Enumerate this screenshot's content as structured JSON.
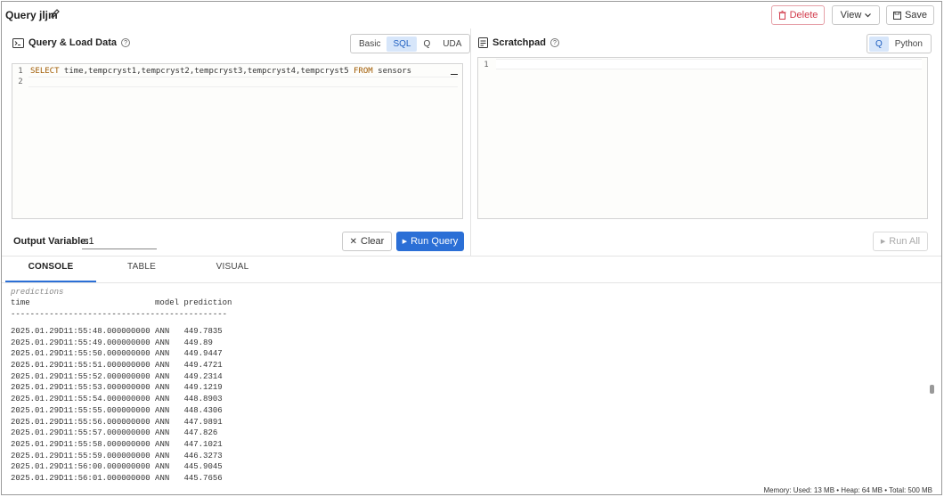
{
  "header": {
    "title": "Query jljm",
    "delete_label": "Delete",
    "view_label": "View",
    "save_label": "Save"
  },
  "query_panel": {
    "title": "Query & Load Data",
    "modes": [
      "Basic",
      "SQL",
      "Q",
      "UDA"
    ],
    "active_mode": "SQL",
    "editor_lines": [
      {
        "num": "1",
        "keyword1": "SELECT",
        "middle": " time,tempcryst1,tempcryst2,tempcryst3,tempcryst4,tempcryst5 ",
        "keyword2": "FROM",
        "tail": " sensors"
      },
      {
        "num": "2"
      }
    ],
    "output_variable_label": "Output Variable:",
    "output_variable_value": "s1",
    "clear_label": "Clear",
    "run_label": "Run Query"
  },
  "scratchpad": {
    "title": "Scratchpad",
    "modes": [
      "Q",
      "Python"
    ],
    "active_mode": "Q",
    "editor_line_number": "1",
    "run_all_label": "Run All"
  },
  "tabs": [
    "CONSOLE",
    "TABLE",
    "VISUAL"
  ],
  "active_tab": "CONSOLE",
  "console": {
    "label": "predictions",
    "header": "time                          model prediction",
    "separator": "---------------------------------------------",
    "rows": [
      {
        "time": "2025.01.29D11:55:48.000000000",
        "model": "ANN",
        "prediction": "449.7835"
      },
      {
        "time": "2025.01.29D11:55:49.000000000",
        "model": "ANN",
        "prediction": "449.89"
      },
      {
        "time": "2025.01.29D11:55:50.000000000",
        "model": "ANN",
        "prediction": "449.9447"
      },
      {
        "time": "2025.01.29D11:55:51.000000000",
        "model": "ANN",
        "prediction": "449.4721"
      },
      {
        "time": "2025.01.29D11:55:52.000000000",
        "model": "ANN",
        "prediction": "449.2314"
      },
      {
        "time": "2025.01.29D11:55:53.000000000",
        "model": "ANN",
        "prediction": "449.1219"
      },
      {
        "time": "2025.01.29D11:55:54.000000000",
        "model": "ANN",
        "prediction": "448.8903"
      },
      {
        "time": "2025.01.29D11:55:55.000000000",
        "model": "ANN",
        "prediction": "448.4306"
      },
      {
        "time": "2025.01.29D11:55:56.000000000",
        "model": "ANN",
        "prediction": "447.9891"
      },
      {
        "time": "2025.01.29D11:55:57.000000000",
        "model": "ANN",
        "prediction": "447.826"
      },
      {
        "time": "2025.01.29D11:55:58.000000000",
        "model": "ANN",
        "prediction": "447.1021"
      },
      {
        "time": "2025.01.29D11:55:59.000000000",
        "model": "ANN",
        "prediction": "446.3273"
      },
      {
        "time": "2025.01.29D11:56:00.000000000",
        "model": "ANN",
        "prediction": "445.9045"
      },
      {
        "time": "2025.01.29D11:56:01.000000000",
        "model": "ANN",
        "prediction": "445.7656"
      }
    ]
  },
  "footer": {
    "memory": "Memory:  Used: 13 MB • Heap: 64 MB • Total: 500 MB"
  },
  "colors": {
    "accent": "#2b6fd6",
    "danger": "#d23b4b",
    "segment_active_bg": "#d7e6fa"
  }
}
